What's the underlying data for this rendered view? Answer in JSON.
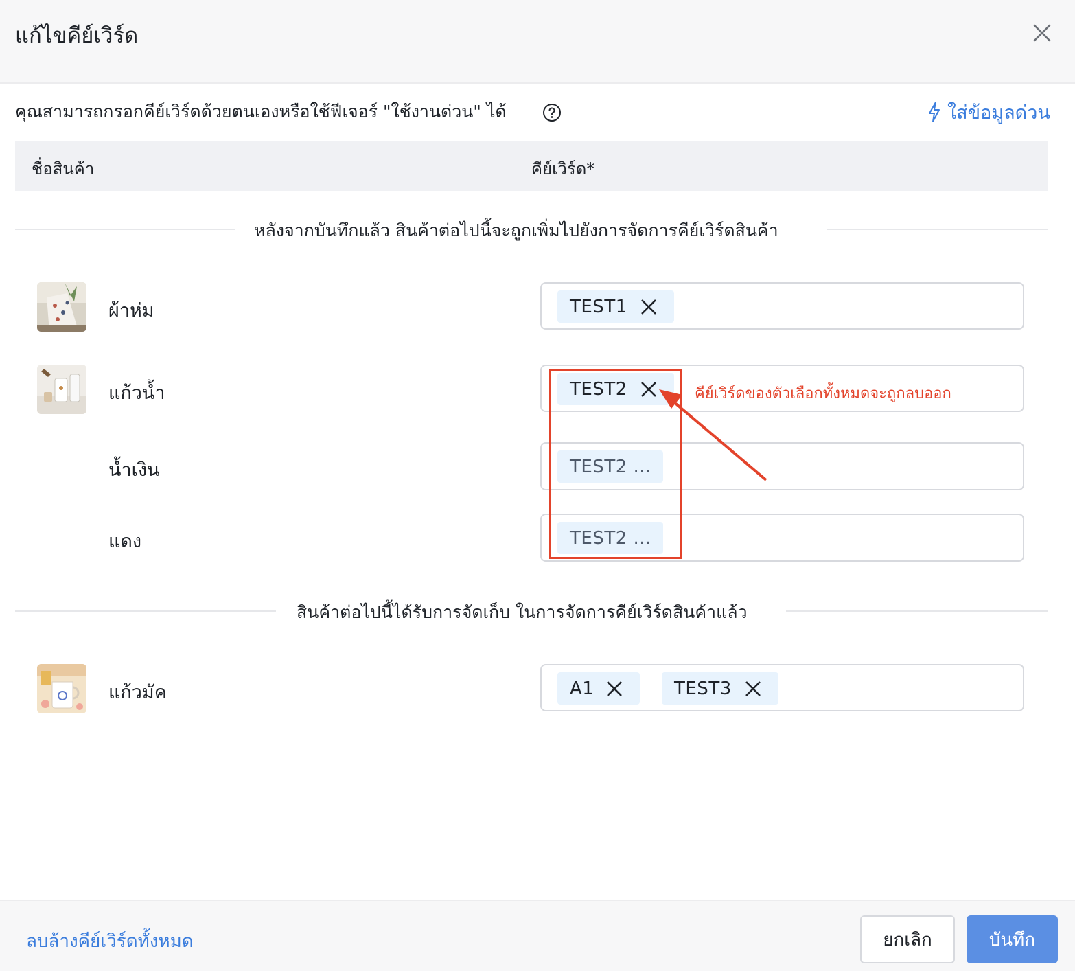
{
  "dialog": {
    "title": "แก้ไขคีย์เวิร์ด"
  },
  "intro": {
    "text": "คุณสามารถกรอกคีย์เวิร์ดด้วยตนเองหรือใช้ฟีเจอร์ \"ใช้งานด่วน\" ได้",
    "help_icon": "question-circle-icon"
  },
  "quick_fill": {
    "label": "ใส่ข้อมูลด่วน",
    "icon": "lightning-icon",
    "color": "#3b7ddd"
  },
  "table_header": {
    "product_name": "ชื่อสินค้า",
    "keyword": "คีย์เวิร์ด*"
  },
  "section_new": {
    "label": "หลังจากบันทึกแล้ว สินค้าต่อไปนี้จะถูกเพิ่มไปยังการจัดการคีย์เวิร์ดสินค้า"
  },
  "products_new": [
    {
      "name": "ผ้าห่ม",
      "tags": [
        {
          "text": "TEST1"
        }
      ]
    },
    {
      "name": "แก้วน้ำ",
      "tags": [
        {
          "text": "TEST2"
        }
      ]
    },
    {
      "name": "น้ำเงิน",
      "tags": [
        {
          "text": "TEST2 ..."
        }
      ]
    },
    {
      "name": "แดง",
      "tags": [
        {
          "text": "TEST2 ..."
        }
      ]
    }
  ],
  "annotation": {
    "text": "คีย์เวิร์ดของตัวเลือกทั้งหมดจะถูกลบออก",
    "color": "#e3432b"
  },
  "section_existing": {
    "label": "สินค้าต่อไปนี้ได้รับการจัดเก็บ ในการจัดการคีย์เวิร์ดสินค้าแล้ว"
  },
  "products_existing": [
    {
      "name": "แก้วมัค",
      "tags": [
        {
          "text": "A1"
        },
        {
          "text": "TEST3"
        }
      ]
    }
  ],
  "footer": {
    "clear_all": "ลบล้างคีย์เวิร์ดทั้งหมด",
    "cancel": "ยกเลิก",
    "save": "บันทึก"
  },
  "colors": {
    "accent": "#3b7ddd",
    "primary_button": "#5b8fe3",
    "tag_bg": "#e8f3fd",
    "annotation": "#e3432b"
  }
}
